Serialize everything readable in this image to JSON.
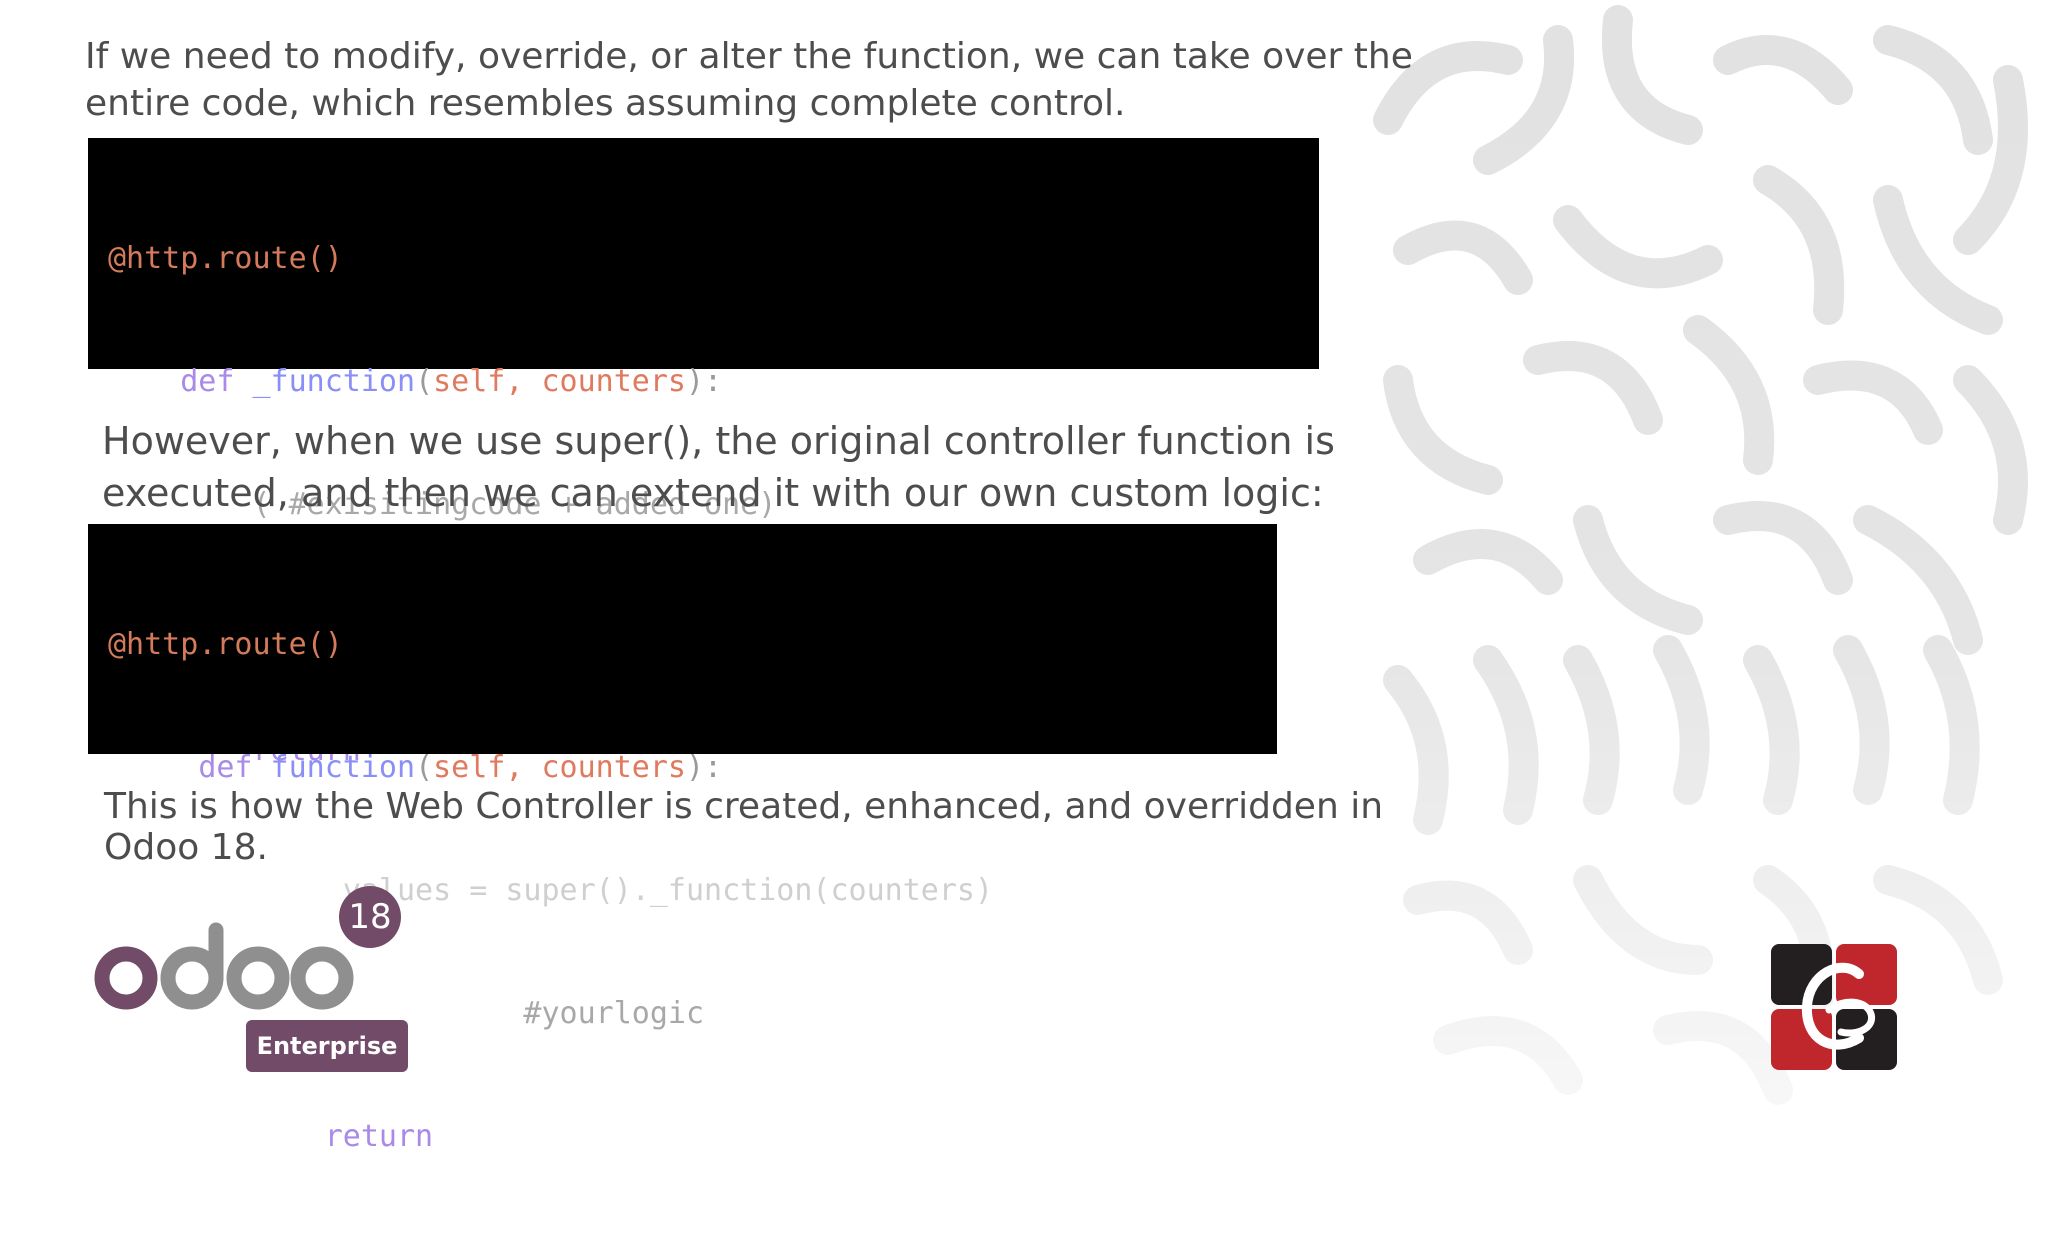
{
  "slide": {
    "intro_text_line1": "If we need to modify, override, or alter the function, we can take over the",
    "intro_text_line2": "entire code, which resembles assuming complete control.",
    "code1": {
      "line1": {
        "deco": "@http.route()"
      },
      "line2": {
        "indent": "    ",
        "kw": "def",
        "fn": " _function",
        "open": "(",
        "params": "self, counters",
        "close": "):"
      },
      "line3": {
        "indent": "        ",
        "text": "( #exisitingcode + added one)"
      },
      "line4": {
        "text": ""
      },
      "line5": {
        "indent": "        ",
        "kw": "return"
      }
    },
    "super_text_line1": "However, when we use super(), the original controller function is",
    "super_text_line2": "executed, and then we can extend it with our own custom logic:",
    "code2": {
      "line1": {
        "deco": "@http.route()"
      },
      "line2": {
        "indent": "     ",
        "kw": "def",
        "fn": " function",
        "open": "(",
        "params": "self, counters",
        "close": "):"
      },
      "line3": {
        "indent": "             ",
        "text": "values = super()._function(counters)"
      },
      "line4": {
        "indent": "                       ",
        "text": "#yourlogic"
      },
      "line5": {
        "indent": "            ",
        "kw": "return"
      }
    },
    "closing_text_line1": "This is how the Web Controller is created, enhanced, and overridden in",
    "closing_text_line2": "Odoo 18."
  },
  "logo": {
    "wordmark": "odoo",
    "version_badge": "18",
    "edition": "Enterprise",
    "colors": {
      "purple": "#714b67",
      "gray": "#8f8f8f"
    }
  },
  "brand_logo": {
    "icon": "cybrosys-logo-icon",
    "colors": {
      "red": "#c0272d",
      "dark": "#231f20"
    }
  }
}
